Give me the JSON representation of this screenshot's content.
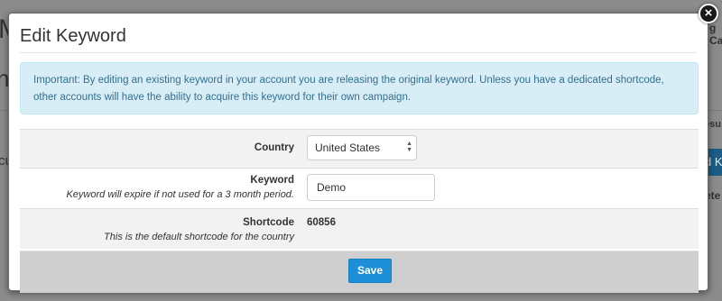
{
  "background": {
    "title_fragment": "M",
    "heading_fragment": "n",
    "left_text_fragment": "cu",
    "top_right_fragment": "g Ca",
    "column_fragment": "esu",
    "button_fragment": "d K",
    "action_fragment": "ete"
  },
  "modal": {
    "title": "Edit Keyword",
    "close_icon": "close-icon",
    "alert_text": "Important: By editing an existing keyword in your account you are releasing the original keyword. Unless you have a dedicated shortcode, other accounts will have the ability to acquire this keyword for their own campaign.",
    "country": {
      "label": "Country",
      "selected": "United States"
    },
    "keyword": {
      "label": "Keyword",
      "hint": "Keyword will expire if not used for a 3 month period.",
      "value": "Demo"
    },
    "shortcode": {
      "label": "Shortcode",
      "hint": "This is the default shortcode for the country",
      "value": "60856"
    },
    "save_label": "Save"
  },
  "colors": {
    "alert_bg": "#d9edf7",
    "alert_text": "#31708f",
    "save_button": "#1d8fd8",
    "footer_bg": "#cfcfcf"
  }
}
